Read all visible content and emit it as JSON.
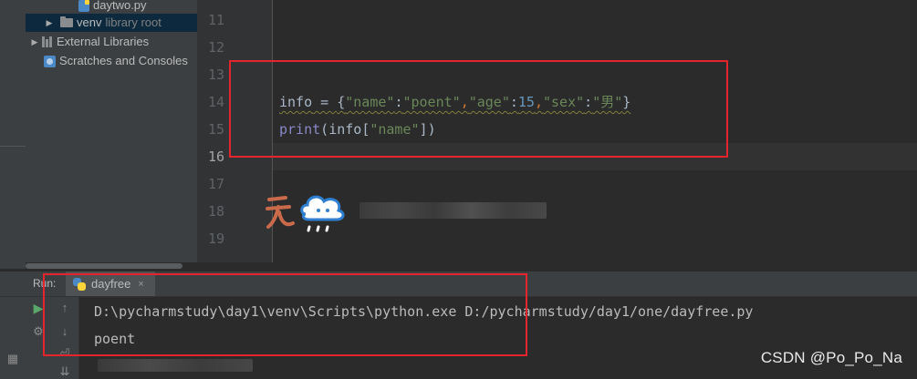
{
  "project_tree": {
    "items": [
      {
        "label": "daytwo.py",
        "suffix": ""
      },
      {
        "label": "venv",
        "suffix": "library root"
      },
      {
        "label": "External Libraries",
        "suffix": ""
      },
      {
        "label": "Scratches and Consoles",
        "suffix": ""
      }
    ]
  },
  "editor": {
    "line_numbers": [
      "11",
      "12",
      "13",
      "14",
      "15",
      "16",
      "17",
      "18",
      "19"
    ],
    "current_line": "16",
    "line14": {
      "var": "info",
      "assign": " = ",
      "open": "{",
      "k1": "\"name\"",
      "c1": ":",
      "v1": "\"poent\"",
      "s1": ",",
      "k2": "\"age\"",
      "c2": ":",
      "v2": "15",
      "s2": ",",
      "k3": "\"sex\"",
      "c3": ":",
      "v3": "\"男\"",
      "close": "}"
    },
    "line15": {
      "func": "print",
      "open": "(",
      "var": "info",
      "lb": "[",
      "key": "\"name\"",
      "rb": "]",
      "close": ")"
    }
  },
  "run_panel": {
    "label": "Run:",
    "tab_name": "dayfree",
    "close_glyph": "×",
    "console": [
      "D:\\pycharmstudy\\day1\\venv\\Scripts\\python.exe D:/pycharmstudy/day1/one/dayfree.py",
      "poent"
    ]
  },
  "watermark": "CSDN @Po_Po_Na",
  "colors": {
    "annotation_red": "#e4252c",
    "string_green": "#6a8759",
    "number_blue": "#6897bb",
    "keyword_orange": "#cc7832"
  }
}
